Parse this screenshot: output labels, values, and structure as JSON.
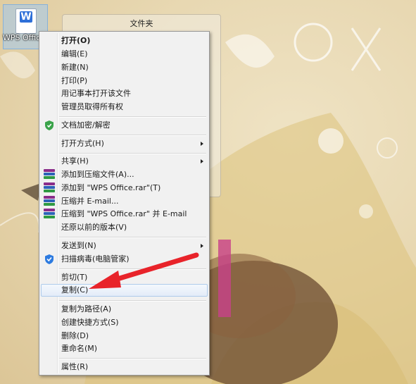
{
  "desktop": {
    "file_label": "WPS Office",
    "file_glyph": "W",
    "folder_window_title": "文件夹"
  },
  "menu": {
    "items": [
      {
        "label": "打开(O)"
      },
      {
        "label": "编辑(E)"
      },
      {
        "label": "新建(N)"
      },
      {
        "label": "打印(P)"
      },
      {
        "label": "用记事本打开该文件"
      },
      {
        "label": "管理员取得所有权"
      },
      {
        "label": "文档加密/解密",
        "icon": "shield-icon"
      },
      {
        "label": "打开方式(H)"
      },
      {
        "label": "共享(H)"
      },
      {
        "label": "添加到压缩文件(A)...",
        "icon": "winrar-icon"
      },
      {
        "label": "添加到 \"WPS Office.rar\"(T)",
        "icon": "winrar-icon"
      },
      {
        "label": "压缩并 E-mail...",
        "icon": "winrar-icon"
      },
      {
        "label": "压缩到 \"WPS Office.rar\" 并 E-mail",
        "icon": "winrar-icon"
      },
      {
        "label": "还原以前的版本(V)"
      },
      {
        "label": "发送到(N)"
      },
      {
        "label": "扫描病毒(电脑管家)",
        "icon": "antivirus-icon"
      },
      {
        "label": "剪切(T)"
      },
      {
        "label": "复制(C)"
      },
      {
        "label": "复制为路径(A)"
      },
      {
        "label": "创建快捷方式(S)"
      },
      {
        "label": "删除(D)"
      },
      {
        "label": "重命名(M)"
      },
      {
        "label": "属性(R)"
      }
    ]
  },
  "colors": {
    "annotation_arrow": "#e8232a",
    "highlight": "#e3ecf8",
    "shield": "#3aa34a",
    "antivirus": "#2d7be0"
  }
}
